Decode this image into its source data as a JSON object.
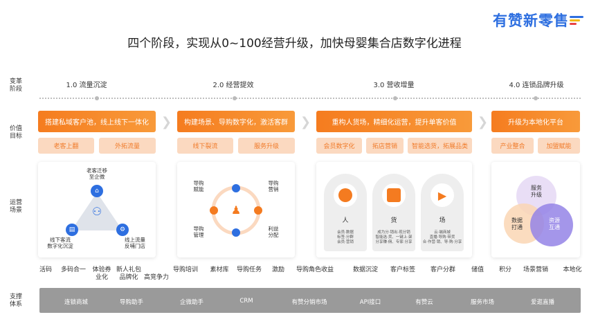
{
  "logo": "有赞新零售",
  "title": "四个阶段，实现从0~100经营升级，加快母婴集合店数字化进程",
  "row_labels": {
    "stage": [
      "变革",
      "阶段"
    ],
    "value": [
      "价值",
      "目标"
    ],
    "scene": [
      "运营",
      "场景"
    ],
    "support": [
      "支撑",
      "体系"
    ]
  },
  "stages": [
    "1.0  流量沉淀",
    "2.0  经营提效",
    "3.0  营收增量",
    "4.0  连锁品牌升级"
  ],
  "value_main": [
    "搭建私域客户池，线上线下一体化",
    "构建场景、导购数字化，激活客群",
    "重构人货场，精细化运营，提升单客价值",
    "升级为本地化平台"
  ],
  "value_sub": [
    [
      "老客上翻",
      "外拓流量"
    ],
    [
      "线下裂流",
      "服务升级"
    ],
    [
      "会员数字化",
      "拓店营销",
      "智能选货，拓展品类"
    ],
    [
      "产业整合",
      "加盟赋能"
    ]
  ],
  "panel1": {
    "top": [
      "老客迁移",
      "至企微"
    ],
    "left": [
      "线下客流",
      "数字化沉淀"
    ],
    "right": [
      "线上流量",
      "反哺门店"
    ]
  },
  "panel2": {
    "tl": [
      "导购",
      "赋能"
    ],
    "tr": [
      "导购",
      "营销"
    ],
    "bl": [
      "导购",
      "管理"
    ],
    "br": [
      "利益",
      "分配"
    ]
  },
  "panel3": {
    "labels": [
      "人",
      "货",
      "场"
    ],
    "desc": [
      [
        "会员·数据",
        "标签·分群",
        "会员·营销"
      ],
      [
        "成为分·销出·现分销",
        "智能选·货、一键上·架",
        "分享赚·佣、专家·分享"
      ],
      [
        "云·端商城",
        "直播·导购·带货",
        "合·作营·销、导·购·分享"
      ]
    ]
  },
  "panel4": {
    "top": [
      "服务",
      "升级"
    ],
    "left": [
      "数据",
      "打通"
    ],
    "right": [
      "资源",
      "互通"
    ]
  },
  "keywords": [
    [
      "活码"
    ],
    [
      "多码合一"
    ],
    [
      "体验券",
      "业化"
    ],
    [
      "新人礼包",
      "品牌化"
    ],
    [
      "高竞争力"
    ],
    [
      "导购培训"
    ],
    [
      "素材库"
    ],
    [
      "导购任务"
    ],
    [
      "激励"
    ],
    [
      "导购角色收益"
    ],
    [
      "数据沉淀"
    ],
    [
      "客户标签"
    ],
    [
      "客户分群"
    ],
    [
      "储值"
    ],
    [
      "积分"
    ],
    [
      "场景营销"
    ],
    [
      "本地化"
    ]
  ],
  "support": [
    "连锁商城",
    "导购助手",
    "企微助手",
    "CRM",
    "有赞分销市场",
    "API接口",
    "有赞云",
    "服务市场",
    "爱逛直播"
  ],
  "colors": {
    "orange": "#f57c1f",
    "peach": "#fbd9c0",
    "blue": "#2e6fe0",
    "gray": "#9a9a9a"
  }
}
